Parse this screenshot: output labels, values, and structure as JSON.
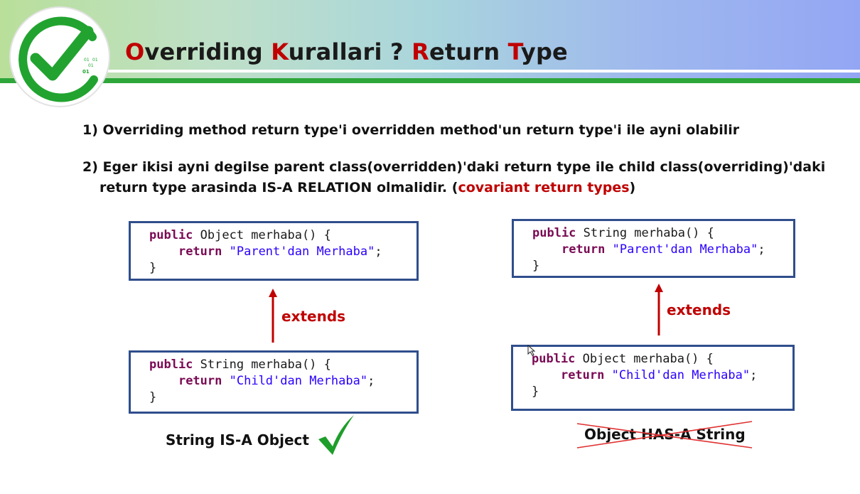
{
  "header": {
    "title_parts": [
      "O",
      "verriding ",
      "K",
      "urallari ? ",
      "R",
      "eturn ",
      "T",
      "ype"
    ],
    "logo_bits": [
      "01",
      "01",
      "01",
      "01"
    ]
  },
  "rules": {
    "rule1": "1) Overriding method return type'i overridden method'un return type'i ile ayni olabilir",
    "rule2_line1": "2) Eger ikisi ayni degilse parent class(overridden)'daki return type ile child class(overriding)'daki",
    "rule2_line2_pre": "return type arasinda IS-A RELATION olmalidir. (",
    "rule2_highlight": "covariant return types",
    "rule2_line2_post": ")"
  },
  "left_example": {
    "parent": {
      "kw": "public",
      "sig": " Object merhaba() {",
      "ret_kw": "return",
      "str": "\"Parent'dan Merhaba\"",
      "end": ";",
      "close": "}"
    },
    "child": {
      "kw": "public",
      "sig": " String merhaba() {",
      "ret_kw": "return",
      "str": "\"Child'dan Merhaba\"",
      "end": ";",
      "close": "}"
    },
    "extends_label": "extends",
    "caption": "String IS-A Object"
  },
  "right_example": {
    "parent": {
      "kw": "public",
      "sig": " String merhaba() {",
      "ret_kw": "return",
      "str": "\"Parent'dan Merhaba\"",
      "end": ";",
      "close": "}"
    },
    "child": {
      "kw": "public",
      "sig": " Object merhaba() {",
      "ret_kw": "return",
      "str": "\"Child'dan Merhaba\"",
      "end": ";",
      "close": "}"
    },
    "extends_label": "extends",
    "caption": "Object HAS-A String"
  },
  "colors": {
    "accent_red": "#c00000",
    "box_border": "#2f4e8c",
    "check_green": "#1e9e2a",
    "keyword": "#7a0a54",
    "string": "#2a00ff"
  },
  "icons": {
    "logo": "checkmark-logo-icon",
    "valid": "checkmark-icon",
    "invalid": "cross-out-icon",
    "cursor": "mouse-cursor-icon"
  }
}
